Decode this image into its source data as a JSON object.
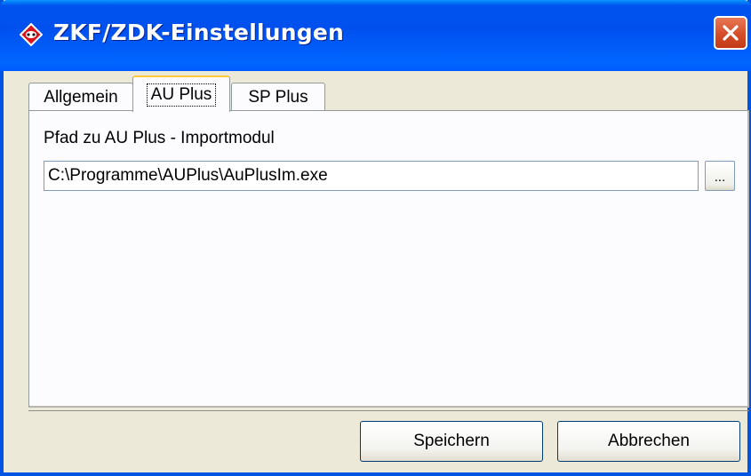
{
  "window": {
    "title": "ZKF/ZDK-Einstellungen",
    "accent_color": "#0054e3",
    "close_color": "#d34a25"
  },
  "tabs": [
    {
      "label": "Allgemein",
      "selected": false
    },
    {
      "label": "AU Plus",
      "selected": true
    },
    {
      "label": "SP Plus",
      "selected": false
    }
  ],
  "panel": {
    "path_label": "Pfad zu AU Plus - Importmodul",
    "path_value": "C:\\Programme\\AUPlus\\AuPlusIm.exe",
    "browse_label": "..."
  },
  "buttons": {
    "save_label": "Speichern",
    "cancel_label": "Abbrechen"
  },
  "icons": {
    "title": "app-diamond-icon",
    "close": "close-icon"
  }
}
